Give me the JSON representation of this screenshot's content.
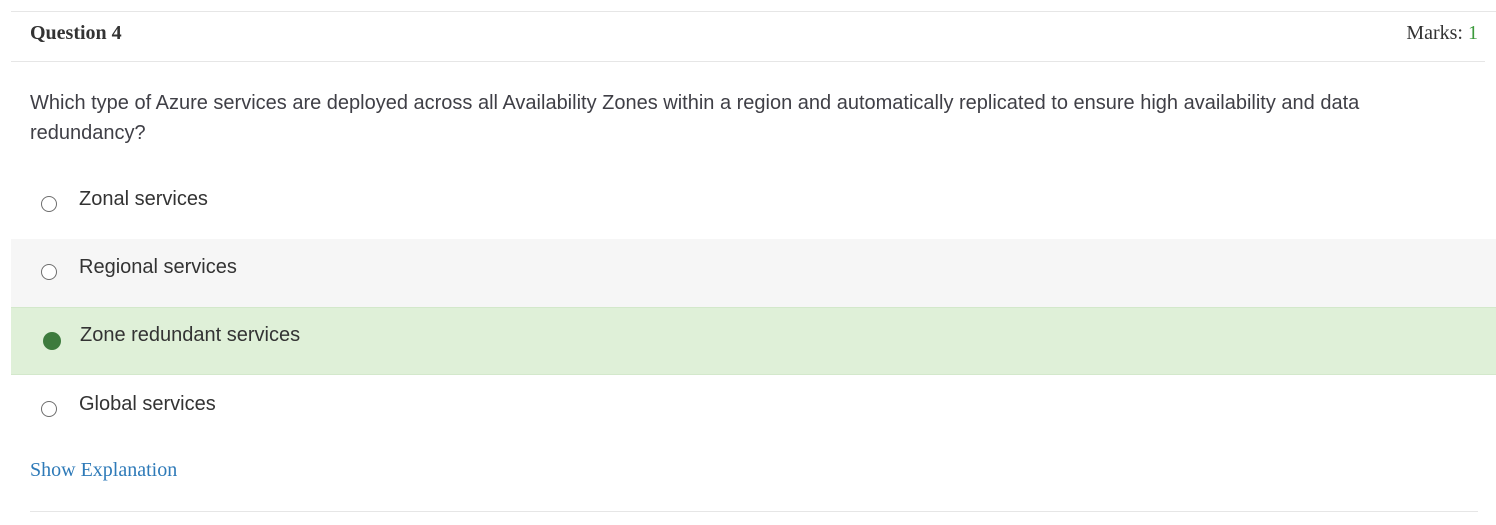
{
  "question": {
    "title": "Question 4",
    "marks_label": "Marks: ",
    "marks_value": "1",
    "text": "Which type of Azure services are deployed across all Availability Zones within a region and automatically replicated to ensure high availability and data redundancy?"
  },
  "options": [
    {
      "label": "Zonal services",
      "selected": false
    },
    {
      "label": "Regional services",
      "selected": false
    },
    {
      "label": "Zone redundant services",
      "selected": true
    },
    {
      "label": "Global services",
      "selected": false
    }
  ],
  "explanation_link": "Show Explanation",
  "colors": {
    "selected_bg": "#dff0d8",
    "selected_radio": "#3d7b3d",
    "hover_bg": "#f6f6f6",
    "link": "#2e7ab8",
    "marks_value": "#3c9a3c"
  }
}
